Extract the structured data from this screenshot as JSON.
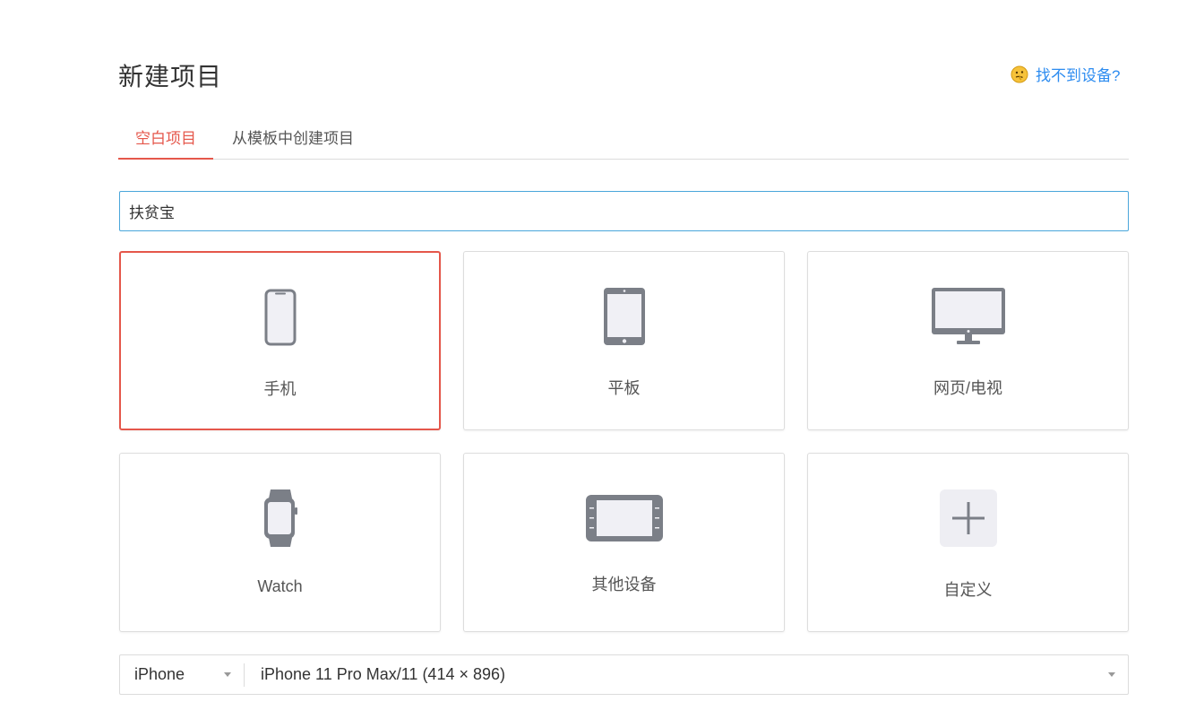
{
  "header": {
    "title": "新建项目",
    "help_link": "找不到设备?"
  },
  "tabs": [
    {
      "label": "空白项目",
      "active": true
    },
    {
      "label": "从模板中创建项目",
      "active": false
    }
  ],
  "project_name": {
    "value": "扶贫宝"
  },
  "device_cards": [
    {
      "label": "手机",
      "icon": "phone-icon",
      "selected": true
    },
    {
      "label": "平板",
      "icon": "tablet-icon",
      "selected": false
    },
    {
      "label": "网页/电视",
      "icon": "monitor-icon",
      "selected": false
    },
    {
      "label": "Watch",
      "icon": "watch-icon",
      "selected": false
    },
    {
      "label": "其他设备",
      "icon": "car-display-icon",
      "selected": false
    },
    {
      "label": "自定义",
      "icon": "plus-icon",
      "selected": false
    }
  ],
  "device_select": {
    "type_value": "iPhone",
    "model_value": "iPhone 11 Pro Max/11 (414 × 896)"
  },
  "colors": {
    "accent": "#e5574b",
    "link": "#2d8cf0",
    "icon_gray": "#7b7f87",
    "icon_fill": "#f0f0f5",
    "input_border": "#4aa6db"
  }
}
